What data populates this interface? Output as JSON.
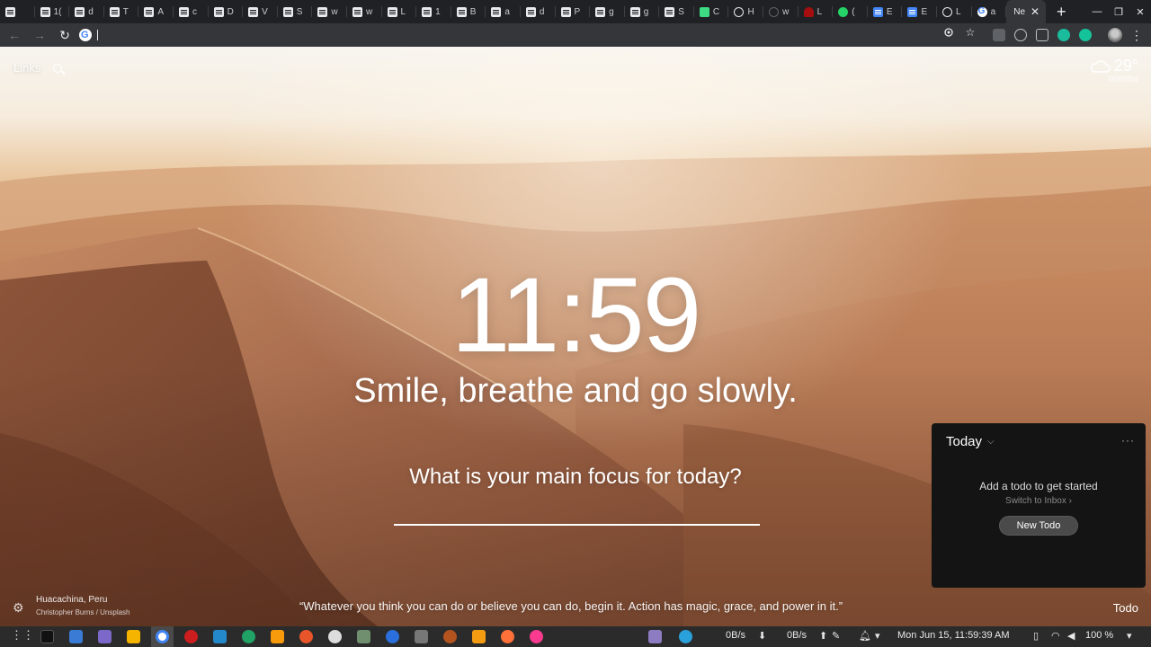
{
  "browser": {
    "tabs": [
      {
        "label": "",
        "icon": "doc-icon"
      },
      {
        "label": "1(",
        "icon": "doc-icon"
      },
      {
        "label": "d",
        "icon": "doc-icon"
      },
      {
        "label": "T",
        "icon": "doc-icon"
      },
      {
        "label": "A",
        "icon": "doc-icon"
      },
      {
        "label": "c",
        "icon": "doc-icon"
      },
      {
        "label": "D",
        "icon": "doc-icon"
      },
      {
        "label": "V",
        "icon": "doc-icon"
      },
      {
        "label": "S",
        "icon": "doc-icon"
      },
      {
        "label": "w",
        "icon": "doc-icon"
      },
      {
        "label": "w",
        "icon": "doc-icon"
      },
      {
        "label": "L",
        "icon": "doc-icon"
      },
      {
        "label": "1",
        "icon": "doc-icon"
      },
      {
        "label": "B",
        "icon": "doc-icon"
      },
      {
        "label": "a",
        "icon": "doc-icon"
      },
      {
        "label": "d",
        "icon": "doc-icon"
      },
      {
        "label": "P",
        "icon": "doc-icon"
      },
      {
        "label": "g",
        "icon": "doc-icon"
      },
      {
        "label": "g",
        "icon": "doc-icon"
      },
      {
        "label": "S",
        "icon": "doc-icon"
      },
      {
        "label": "C",
        "icon": "green-icon"
      },
      {
        "label": "H",
        "icon": "globe-icon"
      },
      {
        "label": "w",
        "icon": "github-icon"
      },
      {
        "label": "L",
        "icon": "heart-icon"
      },
      {
        "label": "(",
        "icon": "whatsapp-icon"
      },
      {
        "label": "E",
        "icon": "gdoc-icon"
      },
      {
        "label": "E",
        "icon": "gdoc-icon"
      },
      {
        "label": "L",
        "icon": "globe-icon"
      },
      {
        "label": "a",
        "icon": "google-icon"
      }
    ],
    "active_tab": {
      "label": "Ne",
      "icon": "google-icon"
    },
    "close_glyph": "✕",
    "new_tab_glyph": "+",
    "omnibox_value": ""
  },
  "momentum": {
    "links_label": "Links",
    "weather": {
      "temp": "29°",
      "location": "Wamba",
      "icon": "cloud-icon"
    },
    "clock": "11:59",
    "mantra": "Smile, breathe and go slowly.",
    "focus_question": "What is your main focus for today?",
    "focus_value": "",
    "photo": {
      "location": "Huacachina, Peru",
      "credit": "Christopher Burns / Unsplash"
    },
    "quote": "“Whatever you think you can do or believe you can do, begin it. Action has magic, grace, and power in it.”",
    "todo_link": "Todo",
    "todo": {
      "title": "Today",
      "more": "···",
      "empty": "Add a todo to get started",
      "switch": "Switch to Inbox ›",
      "new_button": "New Todo"
    }
  },
  "taskbar": {
    "net_down": "0B/s",
    "net_up": "0B/s",
    "datetime": "Mon Jun 15, 11:59:39 AM",
    "volume": "100 %"
  }
}
